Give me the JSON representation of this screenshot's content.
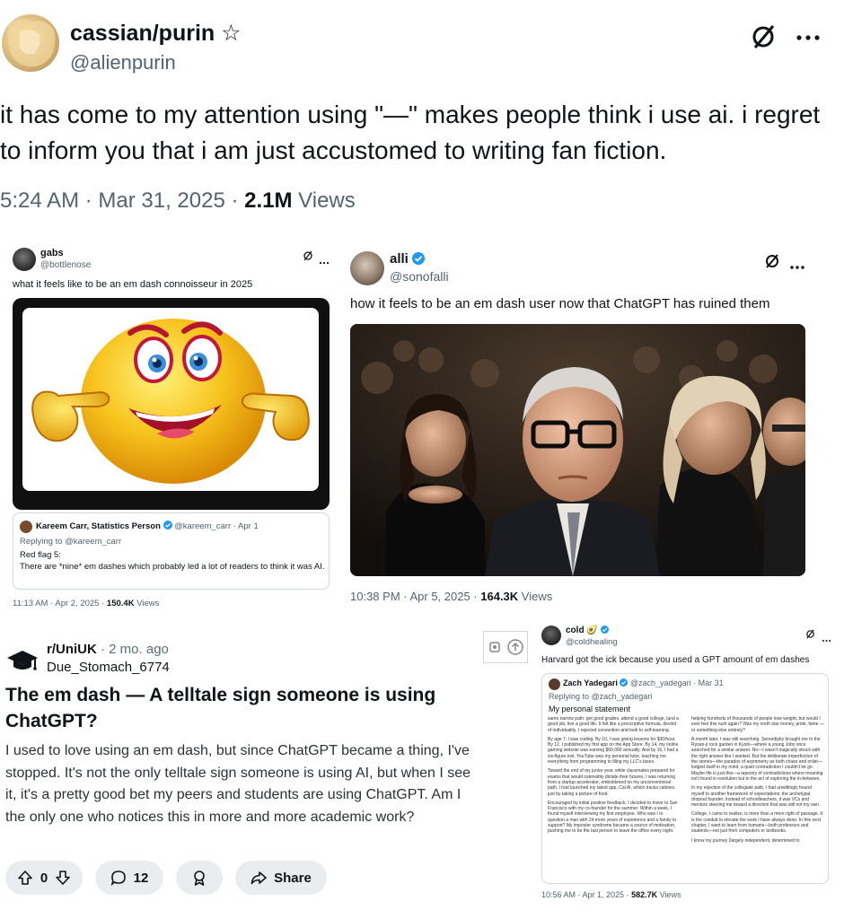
{
  "main_tweet": {
    "display_name": "cassian/purin",
    "name_symbol": "☆",
    "handle": "@alienpurin",
    "text": "it has come to my attention using \"—\" makes people think i use ai. i regret to inform you that i am just accustomed to writing fan fiction.",
    "time_date": "5:24 AM · Mar 31, 2025 · ",
    "views_count": "2.1M",
    "views_label": " Views"
  },
  "gabs_tweet": {
    "display_name": "gabs",
    "handle": "@bottlenose",
    "text": "what it feels like to be an em dash connoisseur in 2025",
    "quoted": {
      "display_name": "Kareem Carr, Statistics Person",
      "handle_time": "@kareem_carr · Apr 1",
      "replying": "Replying to @kareem_carr",
      "line1": "Red flag 5:",
      "line2": "There are *nine* em dashes which probably led a lot of readers to think it was AI."
    },
    "time_date": "11:13 AM · Apr 2, 2025 · ",
    "views_count": "150.4K",
    "views_label": " Views"
  },
  "alli_tweet": {
    "display_name": "alli",
    "handle": "@sonofalli",
    "text": "how it feels to be an em dash user now that ChatGPT has ruined them",
    "time_date": "10:38 PM · Apr 5, 2025 · ",
    "views_count": "164.3K",
    "views_label": " Views"
  },
  "reddit_post": {
    "subreddit": "r/UniUK",
    "time": " · 2 mo. ago",
    "username": "Due_Stomach_6774",
    "title": "The em dash — A telltale sign someone is using ChatGPT?",
    "body": "I used to love using an em dash, but since ChatGPT became a thing, I've stopped. It's not the only telltale sign someone is using AI, but when I see it, it's a pretty good bet my peers and students are using ChatGPT. Am I the only one who notices this in more and more academic work?",
    "votes": "0",
    "comments": "12",
    "share_label": "Share"
  },
  "cold_tweet": {
    "display_name": "cold",
    "name_emoji": "🥑",
    "handle": "@coldhealing",
    "text": "Harvard got the ick because you used a GPT amount of em dashes",
    "quoted": {
      "display_name": "Zach Yadegari",
      "handle_time": "@zach_yadegari · Mar 31",
      "replying": "Replying to @zach_yadegari",
      "title": "My personal statement",
      "col1": [
        "same narrow path: get good grades, attend a good college, land a good job, live a good life. It felt like a prescriptive formula, devoid of individuality. I rejected convention and took to self-learning.",
        "By age 7, I was coding. By 10, I was giving lessons for $30/hour. By 12, I published my first app on the App Store. By 14, my online gaming website was earning $60,000 annually. And by 16, I had a six-figure exit. YouTube was my personal tutor, teaching me everything from programming to filing my LLC's taxes.",
        "Toward the end of my junior year, while classmates prepared for exams that would ostensibly dictate their futures, I was returning from a startup accelerator, emboldened on my unconventional path. I had launched my latest app, Cal AI, which tracks calories just by taking a picture of food.",
        "Encouraged by initial positive feedback, I decided to move to San Francisco with my co-founder for the summer. Within a week, I found myself interviewing my first employee. Who was I to question a man with 24 more years of experience and a family to support? My imposter syndrome became a source of motivation, pushing me to be the last person to leave the office every night."
      ],
      "col2": [
        "helping hundreds of thousands of people lose weight, but would I ever feel this rush again? Was my north star money, pride, fame — or something else entirely?",
        "A month later, I was still searching. Serendipity brought me to the Ryoan-ji rock garden in Kyoto—where a young Jobs once searched for a similar answer. No—I wasn't magically struck with the right answer like I wanted. But the deliberate imperfection of the stones—the paradox of asymmetry as both chaos and order—lodged itself in my mind, a quiet contradiction I couldn't let go. Maybe life is just this—a tapestry of contradictions where meaning isn't found in resolution but in the act of exploring the in-between.",
        "In my rejection of the collegiate path, I had unwittingly bound myself to another framework of expectations: the archetypal dropout founder. Instead of schoolteachers, it was VCs and mentors steering me toward a direction that was still not my own.",
        "College, I came to realize, is more than a mere right of passage. It is the conduit to elevate the work I have always done. In this next chapter, I want to learn from humans—both professors and students—not just from computers or textbooks.",
        "I know my journey (largely independent, determined to"
      ]
    },
    "time_date": "10:56 AM · Apr 1, 2025 · ",
    "views_count": "582.7K",
    "views_label": " Views"
  },
  "icons": {
    "grok": "slashed-circle-icon",
    "more": "ellipsis-icon",
    "verified": "verified-badge-icon",
    "upvote": "arrow-up-icon",
    "downvote": "arrow-down-icon",
    "comment": "speech-bubble-icon",
    "award": "award-icon",
    "share": "share-arrow-icon"
  },
  "colors": {
    "verified_blue": "#1d9bf0",
    "x_secondary_text": "#536471",
    "reddit_pill_bg": "#eaedef"
  }
}
